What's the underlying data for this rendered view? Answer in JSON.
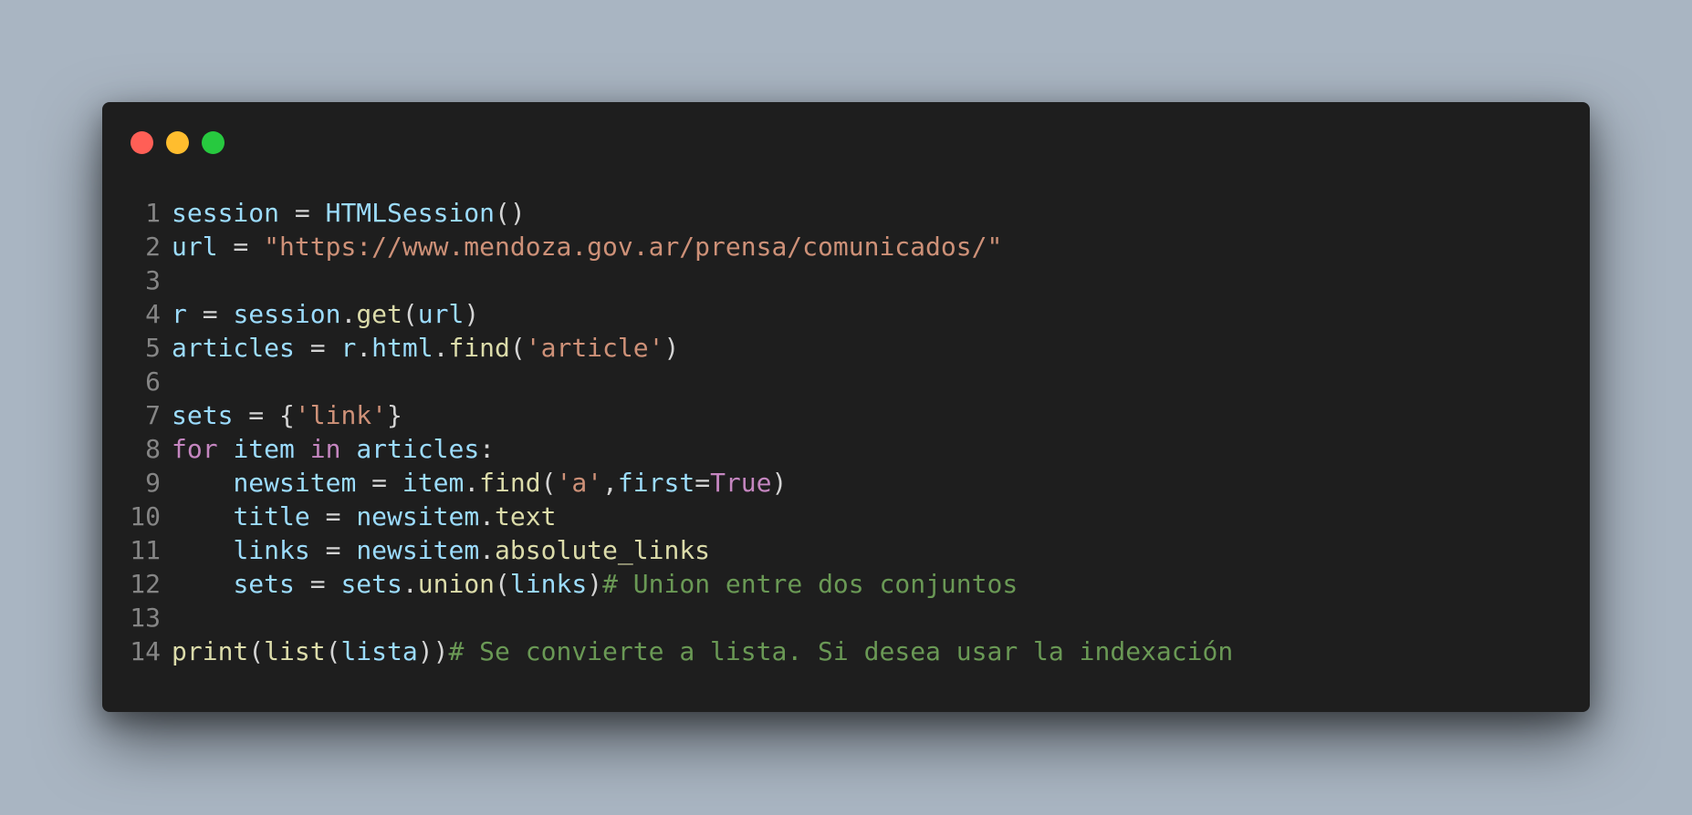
{
  "window": {
    "controls": {
      "close_color": "#ff5f56",
      "minimize_color": "#ffbd2e",
      "maximize_color": "#27c93f"
    }
  },
  "theme": {
    "default": "#d4d4d4",
    "variable": "#9cdcfe",
    "function": "#dcdcaa",
    "string": "#ce9178",
    "keyword": "#c586c0",
    "comment": "#6a9955",
    "line_number": "#858585"
  },
  "code": {
    "lines": [
      {
        "n": "1",
        "tokens": [
          {
            "t": "session",
            "k": "variable"
          },
          {
            "t": " = ",
            "k": "default"
          },
          {
            "t": "HTMLSession",
            "k": "variable"
          },
          {
            "t": "()",
            "k": "default"
          }
        ]
      },
      {
        "n": "2",
        "tokens": [
          {
            "t": "url",
            "k": "variable"
          },
          {
            "t": " = ",
            "k": "default"
          },
          {
            "t": "\"https://www.mendoza.gov.ar/prensa/comunicados/\"",
            "k": "string"
          }
        ]
      },
      {
        "n": "3",
        "tokens": []
      },
      {
        "n": "4",
        "tokens": [
          {
            "t": "r",
            "k": "variable"
          },
          {
            "t": " = ",
            "k": "default"
          },
          {
            "t": "session",
            "k": "variable"
          },
          {
            "t": ".",
            "k": "default"
          },
          {
            "t": "get",
            "k": "function"
          },
          {
            "t": "(",
            "k": "default"
          },
          {
            "t": "url",
            "k": "variable"
          },
          {
            "t": ")",
            "k": "default"
          }
        ]
      },
      {
        "n": "5",
        "tokens": [
          {
            "t": "articles",
            "k": "variable"
          },
          {
            "t": " = ",
            "k": "default"
          },
          {
            "t": "r",
            "k": "variable"
          },
          {
            "t": ".",
            "k": "default"
          },
          {
            "t": "html",
            "k": "variable"
          },
          {
            "t": ".",
            "k": "default"
          },
          {
            "t": "find",
            "k": "function"
          },
          {
            "t": "(",
            "k": "default"
          },
          {
            "t": "'article'",
            "k": "string"
          },
          {
            "t": ")",
            "k": "default"
          }
        ]
      },
      {
        "n": "6",
        "tokens": []
      },
      {
        "n": "7",
        "tokens": [
          {
            "t": "sets",
            "k": "variable"
          },
          {
            "t": " = {",
            "k": "default"
          },
          {
            "t": "'link'",
            "k": "string"
          },
          {
            "t": "}",
            "k": "default"
          }
        ]
      },
      {
        "n": "8",
        "tokens": [
          {
            "t": "for",
            "k": "keyword"
          },
          {
            "t": " ",
            "k": "default"
          },
          {
            "t": "item",
            "k": "variable"
          },
          {
            "t": " ",
            "k": "default"
          },
          {
            "t": "in",
            "k": "keyword"
          },
          {
            "t": " ",
            "k": "default"
          },
          {
            "t": "articles",
            "k": "variable"
          },
          {
            "t": ":",
            "k": "default"
          }
        ]
      },
      {
        "n": "9",
        "tokens": [
          {
            "t": "    ",
            "k": "default"
          },
          {
            "t": "newsitem",
            "k": "variable"
          },
          {
            "t": " = ",
            "k": "default"
          },
          {
            "t": "item",
            "k": "variable"
          },
          {
            "t": ".",
            "k": "default"
          },
          {
            "t": "find",
            "k": "function"
          },
          {
            "t": "(",
            "k": "default"
          },
          {
            "t": "'a'",
            "k": "string"
          },
          {
            "t": ",",
            "k": "default"
          },
          {
            "t": "first",
            "k": "variable"
          },
          {
            "t": "=",
            "k": "default"
          },
          {
            "t": "True",
            "k": "keyword"
          },
          {
            "t": ")",
            "k": "default"
          }
        ]
      },
      {
        "n": "10",
        "tokens": [
          {
            "t": "    ",
            "k": "default"
          },
          {
            "t": "title",
            "k": "variable"
          },
          {
            "t": " = ",
            "k": "default"
          },
          {
            "t": "newsitem",
            "k": "variable"
          },
          {
            "t": ".",
            "k": "default"
          },
          {
            "t": "text",
            "k": "function"
          }
        ]
      },
      {
        "n": "11",
        "tokens": [
          {
            "t": "    ",
            "k": "default"
          },
          {
            "t": "links",
            "k": "variable"
          },
          {
            "t": " = ",
            "k": "default"
          },
          {
            "t": "newsitem",
            "k": "variable"
          },
          {
            "t": ".",
            "k": "default"
          },
          {
            "t": "absolute_links",
            "k": "function"
          }
        ]
      },
      {
        "n": "12",
        "tokens": [
          {
            "t": "    ",
            "k": "default"
          },
          {
            "t": "sets",
            "k": "variable"
          },
          {
            "t": " = ",
            "k": "default"
          },
          {
            "t": "sets",
            "k": "variable"
          },
          {
            "t": ".",
            "k": "default"
          },
          {
            "t": "union",
            "k": "function"
          },
          {
            "t": "(",
            "k": "default"
          },
          {
            "t": "links",
            "k": "variable"
          },
          {
            "t": ")",
            "k": "default"
          },
          {
            "t": "# Union entre dos conjuntos",
            "k": "comment"
          }
        ]
      },
      {
        "n": "13",
        "tokens": []
      },
      {
        "n": "14",
        "tokens": [
          {
            "t": "print",
            "k": "function"
          },
          {
            "t": "(",
            "k": "default"
          },
          {
            "t": "list",
            "k": "function"
          },
          {
            "t": "(",
            "k": "default"
          },
          {
            "t": "lista",
            "k": "variable"
          },
          {
            "t": "))",
            "k": "default"
          },
          {
            "t": "# Se convierte a lista. Si desea usar la indexación",
            "k": "comment"
          }
        ]
      }
    ]
  }
}
